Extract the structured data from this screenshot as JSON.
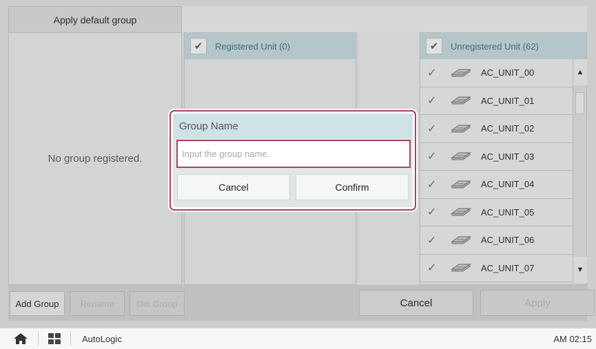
{
  "top": {
    "tab_label": "Apply default group"
  },
  "left_panel": {
    "empty_text": "No group registered."
  },
  "registered": {
    "header": "Registered Unit (0)"
  },
  "unregistered": {
    "header": "Unregistered Unit (62)",
    "units": [
      "AC_UNIT_00",
      "AC_UNIT_01",
      "AC_UNIT_02",
      "AC_UNIT_03",
      "AC_UNIT_04",
      "AC_UNIT_05",
      "AC_UNIT_06",
      "AC_UNIT_07"
    ]
  },
  "actions": {
    "add_group": "Add Group",
    "rename": "Rename",
    "del_group": "Del Group",
    "cancel": "Cancel",
    "apply": "Apply"
  },
  "dialog": {
    "title": "Group Name",
    "placeholder": "Input the group name.",
    "value": "",
    "cancel": "Cancel",
    "confirm": "Confirm"
  },
  "taskbar": {
    "app_name": "AutoLogic",
    "time": "AM 02:15"
  },
  "colors": {
    "accent": "#a84366",
    "header_bg": "#cfe2e6",
    "header_text": "#4a7b86"
  },
  "icons": [
    "check-icon",
    "ac-unit-icon",
    "arrow-up-icon",
    "arrow-down-icon",
    "home-icon",
    "apps-grid-icon"
  ]
}
